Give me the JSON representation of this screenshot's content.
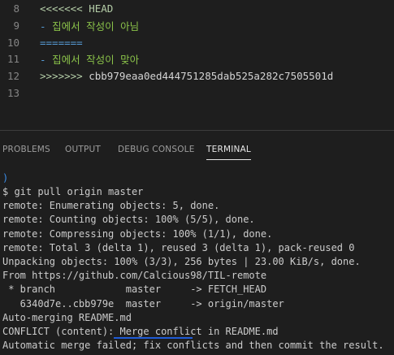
{
  "editor": {
    "lines": [
      {
        "no": "8",
        "parts": [
          {
            "text": "<<<<<<< HEAD",
            "cls": "t-conflict"
          }
        ]
      },
      {
        "no": "9",
        "parts": [
          {
            "text": "- ",
            "cls": "t-minus"
          },
          {
            "text": "집에서 작성이 아님",
            "cls": "t-green"
          }
        ]
      },
      {
        "no": "10",
        "parts": [
          {
            "text": "=======",
            "cls": "t-sep"
          }
        ]
      },
      {
        "no": "11",
        "parts": [
          {
            "text": "- ",
            "cls": "t-minus"
          },
          {
            "text": "집에서 작성이 맞아",
            "cls": "t-green"
          }
        ]
      },
      {
        "no": "12",
        "parts": [
          {
            "text": ">>>>>>> ",
            "cls": "t-conflict"
          },
          {
            "text": "cbb979eaa0ed444751285dab525a282c7505501d",
            "cls": "t-hash"
          }
        ]
      },
      {
        "no": "13",
        "parts": []
      }
    ]
  },
  "panel": {
    "tabs": [
      {
        "label": "PROBLEMS",
        "active": false
      },
      {
        "label": "OUTPUT",
        "active": false
      },
      {
        "label": "DEBUG CONSOLE",
        "active": false
      },
      {
        "label": "TERMINAL",
        "active": true
      }
    ]
  },
  "terminal": {
    "prompt_symbol": ")",
    "lines": [
      "$ git pull origin master",
      "remote: Enumerating objects: 5, done.",
      "remote: Counting objects: 100% (5/5), done.",
      "remote: Compressing objects: 100% (1/1), done.",
      "remote: Total 3 (delta 1), reused 3 (delta 1), pack-reused 0",
      "Unpacking objects: 100% (3/3), 256 bytes | 23.00 KiB/s, done.",
      "From https://github.com/Calcious98/TIL-remote",
      " * branch            master     -> FETCH_HEAD",
      "   6340d7e..cbb979e  master     -> origin/master",
      "Auto-merging README.md",
      "CONFLICT (content): Merge conflict in README.md",
      "Automatic merge failed; fix conflicts and then commit the result."
    ]
  },
  "colors": {
    "background": "#1e1e1e",
    "conflict_marker": "#b5cea8",
    "korean_text": "#8bc34a",
    "underline": "#1f5bd6"
  }
}
